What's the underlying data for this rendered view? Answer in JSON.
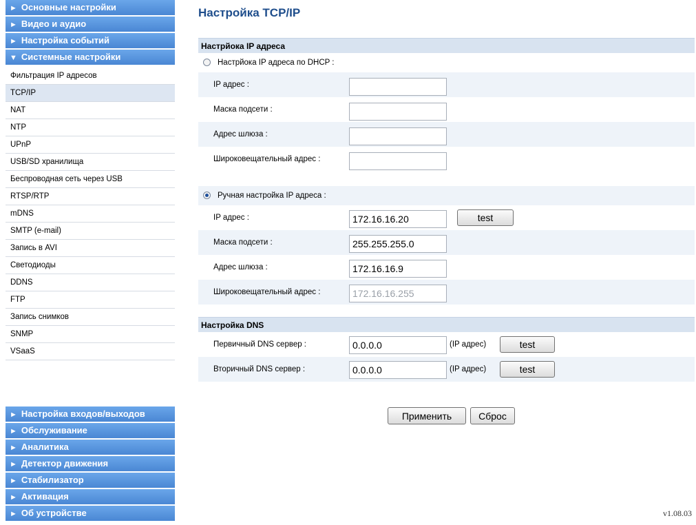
{
  "sidebar": {
    "top_sections": [
      {
        "label": "Основные настройки"
      },
      {
        "label": "Видео и аудио"
      },
      {
        "label": "Настройка событий"
      }
    ],
    "expanded_section": {
      "label": "Системные настройки"
    },
    "subitems": [
      {
        "label": "Фильтрация IP адресов"
      },
      {
        "label": "TCP/IP"
      },
      {
        "label": "NAT"
      },
      {
        "label": "NTP"
      },
      {
        "label": "UPnP"
      },
      {
        "label": "USB/SD хранилища"
      },
      {
        "label": "Беспроводная сеть через USB"
      },
      {
        "label": "RTSP/RTP"
      },
      {
        "label": "mDNS"
      },
      {
        "label": "SMTP (e-mail)"
      },
      {
        "label": "Запись в AVI"
      },
      {
        "label": "Светодиоды"
      },
      {
        "label": "DDNS"
      },
      {
        "label": "FTP"
      },
      {
        "label": "Запись снимков"
      },
      {
        "label": "SNMP"
      },
      {
        "label": "VSaaS"
      }
    ],
    "bottom_sections": [
      {
        "label": "Настройка входов/выходов"
      },
      {
        "label": "Обслуживание"
      },
      {
        "label": "Аналитика"
      },
      {
        "label": "Детектор движения"
      },
      {
        "label": "Стабилизатор"
      },
      {
        "label": "Активация"
      },
      {
        "label": "Об устройстве"
      }
    ],
    "active_item": "TCP/IP"
  },
  "main": {
    "title": "Настройка TCP/IP",
    "ip_section": {
      "header": "Настрйока IP адреса",
      "dhcp": {
        "radio_label": "Настрйока IP адреса по DHCP :",
        "selected": false,
        "fields": [
          {
            "label": "IP адрес :",
            "value": ""
          },
          {
            "label": "Маска подсети :",
            "value": ""
          },
          {
            "label": "Адрес шлюза :",
            "value": ""
          },
          {
            "label": "Широковещательный адрес :",
            "value": ""
          }
        ]
      },
      "manual": {
        "radio_label": "Ручная настройка IP адреса :",
        "selected": true,
        "fields": [
          {
            "label": "IP адрес :",
            "value": "172.16.16.20"
          },
          {
            "label": "Маска подсети :",
            "value": "255.255.255.0"
          },
          {
            "label": "Адрес шлюза :",
            "value": "172.16.16.9"
          },
          {
            "label": "Широковещательный адрес :",
            "value": "172.16.16.255"
          }
        ],
        "test_label": "test"
      }
    },
    "dns_section": {
      "header": "Настройка DNS",
      "primary": {
        "label": "Первичный DNS сервер :",
        "value": "0.0.0.0",
        "note": "(IP адрес)",
        "test_label": "test"
      },
      "secondary": {
        "label": "Вторичный DNS сервер :",
        "value": "0.0.0.0",
        "note": "(IP адрес)",
        "test_label": "test"
      }
    },
    "actions": {
      "apply_label": "Применить",
      "reset_label": "Сброс"
    }
  },
  "footer": {
    "version": "v1.08.03"
  },
  "icons": {
    "collapsed": "triangle-right-icon",
    "expanded": "triangle-down-icon"
  },
  "colors": {
    "sidebar_accent": "#4a87d4",
    "title": "#1f4e8c",
    "section_header_bg": "#d8e3f0",
    "alt_row_bg": "#eef3f9",
    "active_item_bg": "#dde6f2"
  }
}
